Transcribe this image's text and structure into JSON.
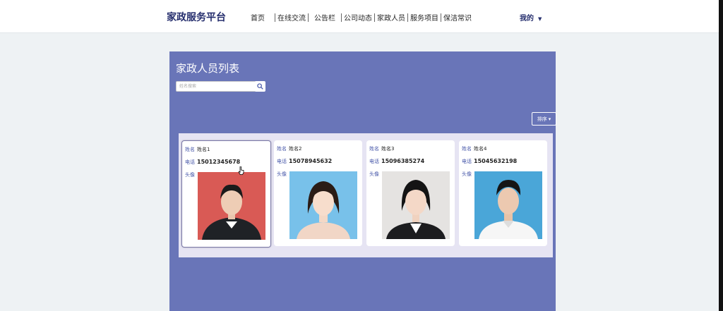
{
  "header": {
    "brand": "家政服务平台",
    "nav": [
      "首页",
      "在线交流",
      "公告栏",
      "公司动态",
      "家政人员",
      "服务项目",
      "保洁常识"
    ],
    "user_menu": "我的"
  },
  "main": {
    "title": "家政人员列表",
    "search_placeholder": "姓名搜索",
    "sort_label": "排序"
  },
  "labels": {
    "name": "姓名",
    "phone": "电话",
    "avatar": "头像"
  },
  "cards": [
    {
      "name": "姓名1",
      "phone": "15012345678",
      "bg": "#d95a55"
    },
    {
      "name": "姓名2",
      "phone": "15078945632",
      "bg": "#78c1ea"
    },
    {
      "name": "姓名3",
      "phone": "15096385274",
      "bg": "#e5e3e1"
    },
    {
      "name": "姓名4",
      "phone": "15045632198",
      "bg": "#4aa6d8"
    }
  ]
}
